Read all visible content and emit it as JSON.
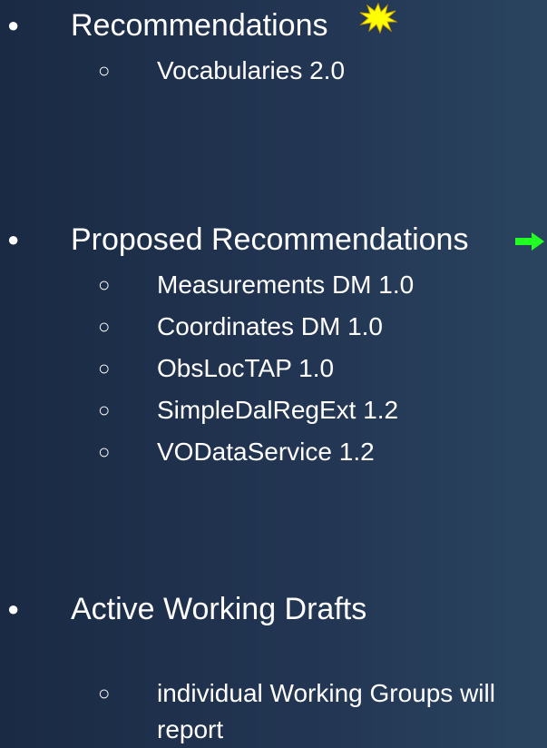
{
  "sections": [
    {
      "bullet": "●",
      "title": "Recommendations",
      "title_icon": "starburst-icon",
      "items": [
        {
          "bullet": "○",
          "label": "Vocabularies 2.0"
        }
      ]
    },
    {
      "bullet": "●",
      "title": "Proposed Recommendations",
      "title_icon": "right-arrow-icon",
      "items": [
        {
          "bullet": "○",
          "label": "Measurements DM 1.0"
        },
        {
          "bullet": "○",
          "label": "Coordinates DM 1.0"
        },
        {
          "bullet": "○",
          "label": "ObsLocTAP 1.0"
        },
        {
          "bullet": "○",
          "label": "SimpleDalRegExt 1.2"
        },
        {
          "bullet": "○",
          "label": "VODataService 1.2"
        }
      ]
    },
    {
      "bullet": "●",
      "title": "Active Working Drafts",
      "items": [
        {
          "bullet": "○",
          "label": "individual Working Groups will report"
        }
      ]
    }
  ],
  "colors": {
    "starburst": "#ffff00",
    "starburst_outline": "#c8a000",
    "arrow": "#22ff22"
  }
}
